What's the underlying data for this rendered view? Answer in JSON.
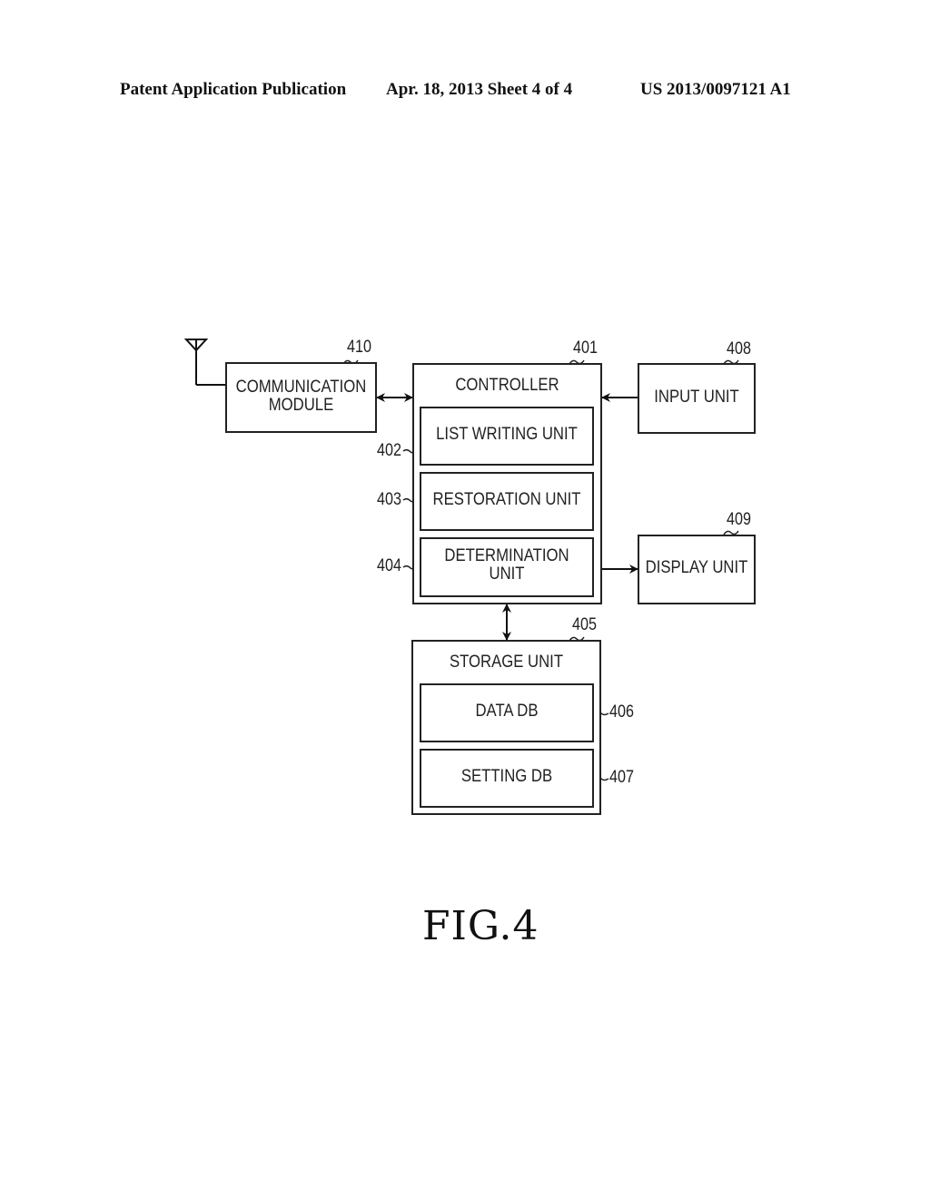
{
  "header": {
    "left": "Patent Application Publication",
    "center": "Apr. 18, 2013  Sheet 4 of 4",
    "right": "US 2013/0097121 A1"
  },
  "diagram": {
    "communication_module": {
      "label_line1": "COMMUNICATION",
      "label_line2": "MODULE",
      "ref": "410"
    },
    "controller": {
      "label": "CONTROLLER",
      "ref": "401"
    },
    "list_writing_unit": {
      "label": "LIST WRITING UNIT",
      "ref": "402"
    },
    "restoration_unit": {
      "label": "RESTORATION UNIT",
      "ref": "403"
    },
    "determination_unit": {
      "label_line1": "DETERMINATION",
      "label_line2": "UNIT",
      "ref": "404"
    },
    "input_unit": {
      "label": "INPUT UNIT",
      "ref": "408"
    },
    "display_unit": {
      "label": "DISPLAY UNIT",
      "ref": "409"
    },
    "storage_unit": {
      "label": "STORAGE UNIT",
      "ref": "405"
    },
    "data_db": {
      "label": "DATA DB",
      "ref": "406"
    },
    "setting_db": {
      "label": "SETTING DB",
      "ref": "407"
    },
    "connections": [
      {
        "from": "communication_module",
        "to": "controller",
        "type": "bidirectional"
      },
      {
        "from": "input_unit",
        "to": "controller",
        "type": "unidirectional"
      },
      {
        "from": "controller",
        "to": "display_unit",
        "type": "unidirectional"
      },
      {
        "from": "controller",
        "to": "storage_unit",
        "type": "bidirectional"
      },
      {
        "from": "antenna",
        "to": "communication_module",
        "type": "line"
      }
    ]
  },
  "figure_label": "FIG.4"
}
